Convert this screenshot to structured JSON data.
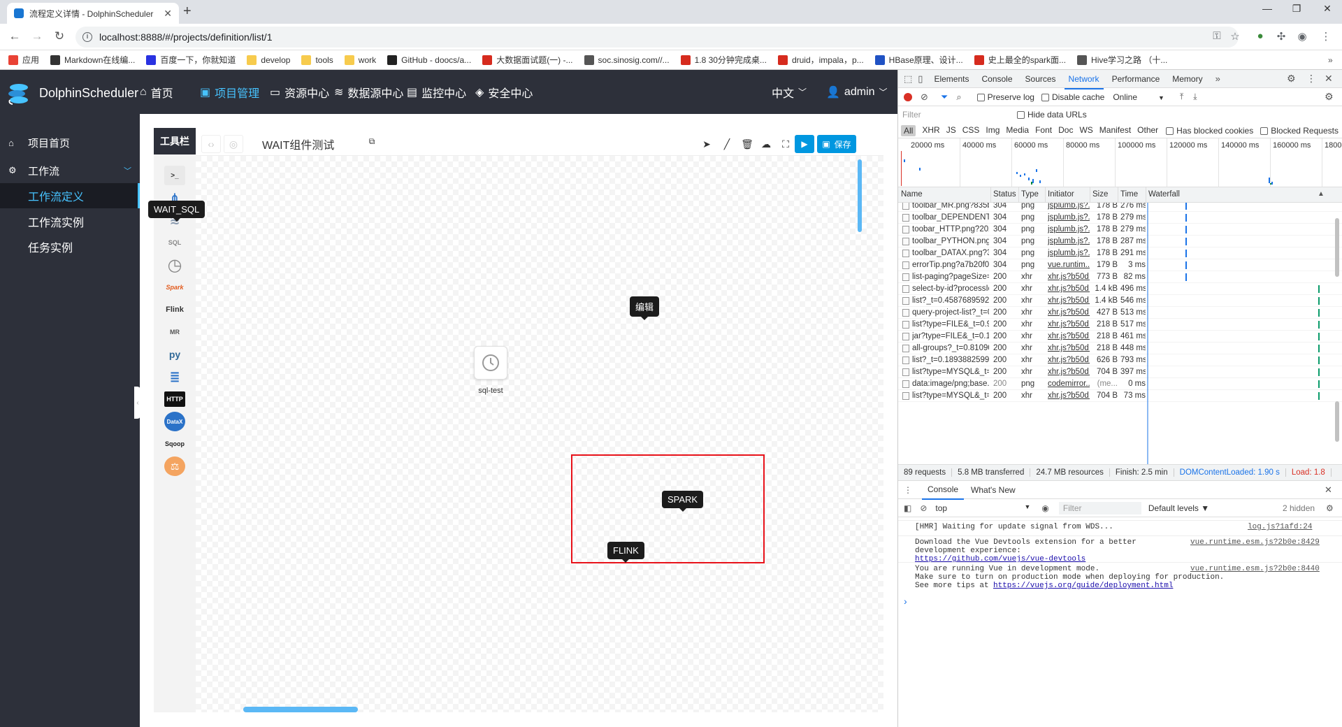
{
  "browser": {
    "tab_title": "流程定义详情 - DolphinScheduler",
    "url": "localhost:8888/#/projects/definition/list/1",
    "bookmarks": [
      {
        "label": "应用",
        "color": "#e94235"
      },
      {
        "label": "Markdown在线编...",
        "color": "#333333"
      },
      {
        "label": "百度一下，你就知道",
        "color": "#2932e1"
      },
      {
        "label": "develop",
        "color": "#f7cb4d"
      },
      {
        "label": "tools",
        "color": "#f7cb4d"
      },
      {
        "label": "work",
        "color": "#f7cb4d"
      },
      {
        "label": "GitHub - doocs/a...",
        "color": "#222222"
      },
      {
        "label": "大数据面试题(一) -...",
        "color": "#d62b1e"
      },
      {
        "label": "soc.sinosig.com//...",
        "color": "#555555"
      },
      {
        "label": "1.8 30分钟完成桌...",
        "color": "#d62b1e"
      },
      {
        "label": "druid，impala，p...",
        "color": "#d62b1e"
      },
      {
        "label": "HBase原理、设计...",
        "color": "#2052c4"
      },
      {
        "label": "史上最全的spark面...",
        "color": "#d62b1e"
      },
      {
        "label": "Hive学习之路 （十...",
        "color": "#555555"
      }
    ]
  },
  "app": {
    "logo": "DolphinScheduler",
    "nav": [
      {
        "label": "首页",
        "icon": "home-icon",
        "glyph": "⌂"
      },
      {
        "label": "项目管理",
        "icon": "project-icon",
        "glyph": "▣"
      },
      {
        "label": "资源中心",
        "icon": "folder-icon",
        "glyph": "▭"
      },
      {
        "label": "数据源中心",
        "icon": "database-icon",
        "glyph": "≋"
      },
      {
        "label": "监控中心",
        "icon": "monitor-icon",
        "glyph": "▤"
      },
      {
        "label": "安全中心",
        "icon": "shield-icon",
        "glyph": "◈"
      }
    ],
    "lang": "中文",
    "user": "admin",
    "sidebar": {
      "home": "项目首页",
      "workflow": "工作流",
      "items": [
        "工作流定义",
        "工作流实例",
        "任务实例"
      ]
    },
    "toolbox_title": "工具栏",
    "tools": [
      {
        "name": "shell",
        "label": ">_"
      },
      {
        "name": "sub-process",
        "label": "⋔"
      },
      {
        "name": "procedure",
        "label": "≋"
      },
      {
        "name": "sql",
        "label": "SQL"
      },
      {
        "name": "wait",
        "label": "◷"
      },
      {
        "name": "spark",
        "label": "Spark"
      },
      {
        "name": "flink",
        "label": "Flink"
      },
      {
        "name": "mr",
        "label": "MR"
      },
      {
        "name": "python",
        "label": "py"
      },
      {
        "name": "dependent",
        "label": "≣"
      },
      {
        "name": "http",
        "label": "HTTP"
      },
      {
        "name": "datax",
        "label": "DataX"
      },
      {
        "name": "sqoop",
        "label": "Sqoop"
      },
      {
        "name": "conditions",
        "label": "⚖"
      }
    ],
    "flow_name": "WAIT组件测试",
    "save_label": "保存",
    "node_label": "sql-test",
    "tooltips": {
      "wait_sql": "WAIT_SQL",
      "edit": "编辑",
      "spark": "SPARK",
      "flink": "FLINK"
    },
    "colors": {
      "accent": "#47c3ff",
      "primary_button": "#0097e0",
      "highlight_box": "#e8121a",
      "sidebar_bg": "#2d303a"
    }
  },
  "devtools": {
    "tabs": [
      "Elements",
      "Console",
      "Sources",
      "Network",
      "Performance",
      "Memory"
    ],
    "active_tab": "Network",
    "preserve_log": "Preserve log",
    "disable_cache": "Disable cache",
    "throttle": "Online",
    "filter_placeholder": "Filter",
    "hide_data_urls": "Hide data URLs",
    "types": [
      "All",
      "XHR",
      "JS",
      "CSS",
      "Img",
      "Media",
      "Font",
      "Doc",
      "WS",
      "Manifest",
      "Other"
    ],
    "blocked_cookies": "Has blocked cookies",
    "blocked_requests": "Blocked Requests",
    "timeline_ticks": [
      "20000 ms",
      "40000 ms",
      "60000 ms",
      "80000 ms",
      "100000 ms",
      "120000 ms",
      "140000 ms",
      "160000 ms",
      "1800"
    ],
    "columns": [
      "Name",
      "Status",
      "Type",
      "Initiator",
      "Size",
      "Time",
      "Waterfall"
    ],
    "rows": [
      {
        "name": "toolbar_MR.png?835bc...",
        "status": "304",
        "type": "png",
        "initiator": "jsplumb.js?...",
        "size": "178 B",
        "time": "276 ms",
        "wf": 0.21
      },
      {
        "name": "toolbar_DEPENDENT.p...",
        "status": "304",
        "type": "png",
        "initiator": "jsplumb.js?...",
        "size": "178 B",
        "time": "279 ms",
        "wf": 0.21
      },
      {
        "name": "toobar_HTTP.png?2029...",
        "status": "304",
        "type": "png",
        "initiator": "jsplumb.js?...",
        "size": "178 B",
        "time": "279 ms",
        "wf": 0.21
      },
      {
        "name": "toolbar_PYTHON.png?...",
        "status": "304",
        "type": "png",
        "initiator": "jsplumb.js?...",
        "size": "178 B",
        "time": "287 ms",
        "wf": 0.21
      },
      {
        "name": "toolbar_DATAX.png?39...",
        "status": "304",
        "type": "png",
        "initiator": "jsplumb.js?...",
        "size": "178 B",
        "time": "291 ms",
        "wf": 0.21
      },
      {
        "name": "errorTip.png?a7b20f0c...",
        "status": "304",
        "type": "png",
        "initiator": "vue.runtim...",
        "size": "179 B",
        "time": "3 ms",
        "wf": 0.21
      },
      {
        "name": "list-paging?pageSize=1...",
        "status": "200",
        "type": "xhr",
        "initiator": "xhr.js?b50d...",
        "size": "773 B",
        "time": "82 ms",
        "wf": 0.21
      },
      {
        "name": "select-by-id?processId...",
        "status": "200",
        "type": "xhr",
        "initiator": "xhr.js?b50d...",
        "size": "1.4 kB",
        "time": "496 ms",
        "wf": 0.97
      },
      {
        "name": "list?_t=0.458768959239...",
        "status": "200",
        "type": "xhr",
        "initiator": "xhr.js?b50d...",
        "size": "1.4 kB",
        "time": "546 ms",
        "wf": 0.97
      },
      {
        "name": "query-project-list?_t=0....",
        "status": "200",
        "type": "xhr",
        "initiator": "xhr.js?b50d...",
        "size": "427 B",
        "time": "513 ms",
        "wf": 0.97
      },
      {
        "name": "list?type=FILE&_t=0.91...",
        "status": "200",
        "type": "xhr",
        "initiator": "xhr.js?b50d...",
        "size": "218 B",
        "time": "517 ms",
        "wf": 0.97
      },
      {
        "name": "jar?type=FILE&_t=0.12...",
        "status": "200",
        "type": "xhr",
        "initiator": "xhr.js?b50d...",
        "size": "218 B",
        "time": "461 ms",
        "wf": 0.97
      },
      {
        "name": "all-groups?_t=0.810907...",
        "status": "200",
        "type": "xhr",
        "initiator": "xhr.js?b50d...",
        "size": "218 B",
        "time": "448 ms",
        "wf": 0.97
      },
      {
        "name": "list?_t=0.189388259948...",
        "status": "200",
        "type": "xhr",
        "initiator": "xhr.js?b50d...",
        "size": "626 B",
        "time": "793 ms",
        "wf": 0.97
      },
      {
        "name": "list?type=MYSQL&_t=0....",
        "status": "200",
        "type": "xhr",
        "initiator": "xhr.js?b50d...",
        "size": "704 B",
        "time": "397 ms",
        "wf": 0.97
      },
      {
        "name": "data:image/png;base...",
        "status": "200",
        "type": "png",
        "initiator": "codemirror....",
        "size": "(me...",
        "time": "0 ms",
        "wf": 0.97
      },
      {
        "name": "list?type=MYSQL&_t=0....",
        "status": "200",
        "type": "xhr",
        "initiator": "xhr.js?b50d...",
        "size": "704 B",
        "time": "73 ms",
        "wf": 0.97
      }
    ],
    "summary": [
      "89 requests",
      "5.8 MB transferred",
      "24.7 MB resources",
      "Finish: 2.5 min",
      "DOMContentLoaded: 1.90 s",
      "Load: 1.8"
    ],
    "drawer_tabs": [
      "Console",
      "What's New"
    ],
    "context": "top",
    "default_levels": "Default levels ▼",
    "hidden": "2 hidden",
    "console": [
      {
        "text": "[HMR] Waiting for update signal from WDS...",
        "src": "log.js?1afd:24"
      },
      {
        "text": "Download the Vue Devtools extension for a better\ndevelopment experience:",
        "link": "https://github.com/vuejs/vue-devtools",
        "src": "vue.runtime.esm.js?2b0e:8429"
      },
      {
        "text": "You are running Vue in development mode.\nMake sure to turn on production mode when deploying for production.\nSee more tips at",
        "link": "https://vuejs.org/guide/deployment.html",
        "src": "vue.runtime.esm.js?2b0e:8440"
      }
    ],
    "prompt": "›"
  }
}
